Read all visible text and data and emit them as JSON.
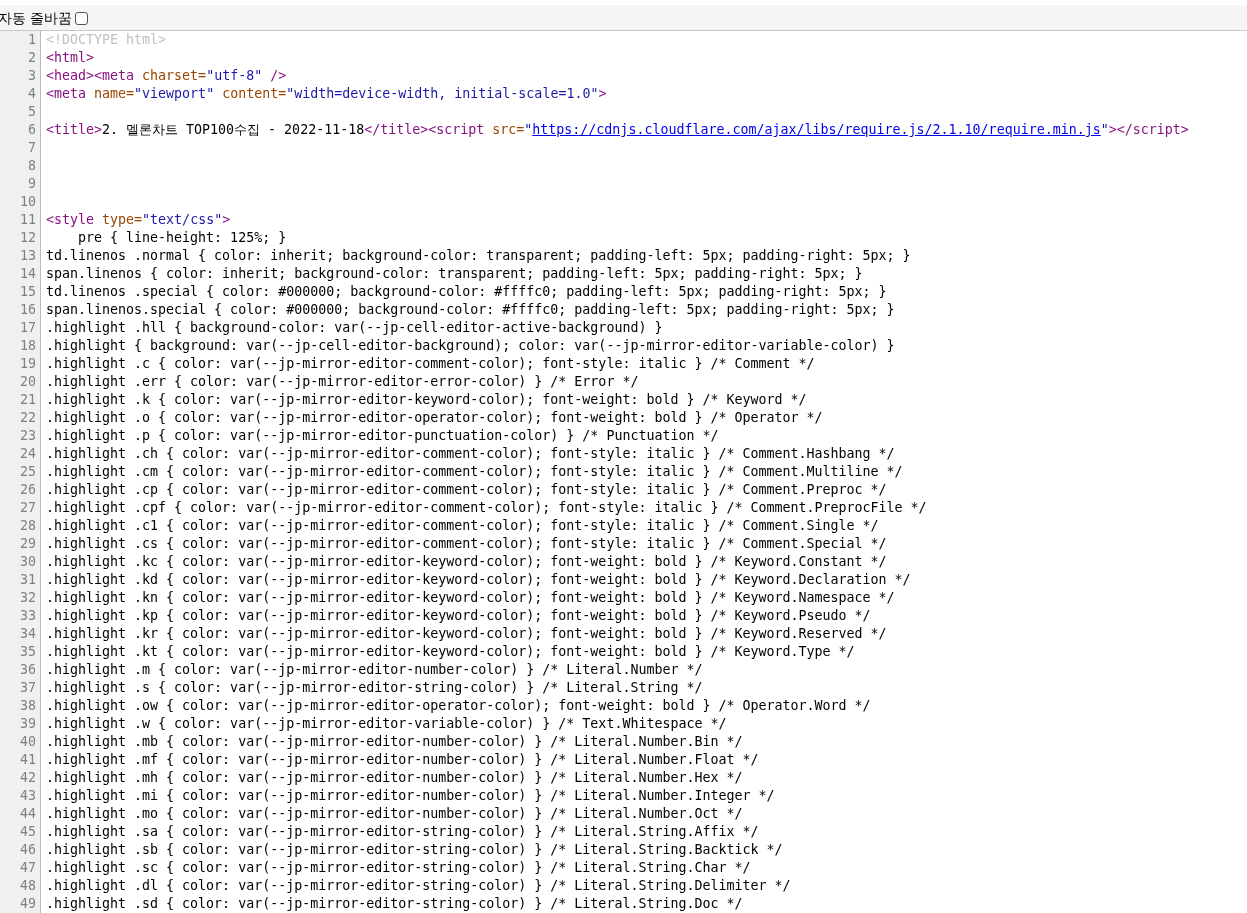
{
  "toolbar": {
    "wrap_checkbox": {
      "label": "자동 줄바꿈",
      "checked": false
    }
  },
  "lines": [
    {
      "number": "1",
      "tokens": [
        {
          "kind": "doctype",
          "text": "<!DOCTYPE html>"
        }
      ]
    },
    {
      "number": "2",
      "tokens": [
        {
          "kind": "tag",
          "text": "<html>"
        }
      ]
    },
    {
      "number": "3",
      "tokens": [
        {
          "kind": "tag",
          "text": "<head><meta"
        },
        {
          "kind": "attr",
          "text": " charset="
        },
        {
          "kind": "value",
          "text": "\"utf-8\""
        },
        {
          "kind": "tag",
          "text": " />"
        }
      ]
    },
    {
      "number": "4",
      "tokens": [
        {
          "kind": "tag",
          "text": "<meta"
        },
        {
          "kind": "attr",
          "text": " name="
        },
        {
          "kind": "value",
          "text": "\"viewport\""
        },
        {
          "kind": "attr",
          "text": " content="
        },
        {
          "kind": "value",
          "text": "\"width=device-width, initial-scale=1.0\""
        },
        {
          "kind": "tag",
          "text": ">"
        }
      ]
    },
    {
      "number": "5"
    },
    {
      "number": "6",
      "tokens": [
        {
          "kind": "tag",
          "text": "<title>"
        },
        {
          "kind": "text",
          "text": "2. 멜론차트 TOP100수집 - 2022-11-18"
        },
        {
          "kind": "tag",
          "text": "</title><script"
        },
        {
          "kind": "attr",
          "text": " src="
        },
        {
          "kind": "value",
          "text": "\""
        },
        {
          "kind": "link",
          "text": "https://cdnjs.cloudflare.com/ajax/libs/require.js/2.1.10/require.min.js"
        },
        {
          "kind": "value",
          "text": "\""
        },
        {
          "kind": "tag",
          "text": "></script>"
        }
      ]
    },
    {
      "number": "7"
    },
    {
      "number": "8"
    },
    {
      "number": "9"
    },
    {
      "number": "10"
    },
    {
      "number": "11",
      "tokens": [
        {
          "kind": "tag",
          "text": "<style"
        },
        {
          "kind": "attr",
          "text": " type="
        },
        {
          "kind": "value",
          "text": "\"text/css\""
        },
        {
          "kind": "tag",
          "text": ">"
        }
      ]
    },
    {
      "number": "12",
      "tokens": [
        {
          "kind": "text",
          "text": "    pre { line-height: 125%; }"
        }
      ]
    },
    {
      "number": "13",
      "tokens": [
        {
          "kind": "text",
          "text": "td.linenos .normal { color: inherit; background-color: transparent; padding-left: 5px; padding-right: 5px; }"
        }
      ]
    },
    {
      "number": "14",
      "tokens": [
        {
          "kind": "text",
          "text": "span.linenos { color: inherit; background-color: transparent; padding-left: 5px; padding-right: 5px; }"
        }
      ]
    },
    {
      "number": "15",
      "tokens": [
        {
          "kind": "text",
          "text": "td.linenos .special { color: #000000; background-color: #ffffc0; padding-left: 5px; padding-right: 5px; }"
        }
      ]
    },
    {
      "number": "16",
      "tokens": [
        {
          "kind": "text",
          "text": "span.linenos.special { color: #000000; background-color: #ffffc0; padding-left: 5px; padding-right: 5px; }"
        }
      ]
    },
    {
      "number": "17",
      "tokens": [
        {
          "kind": "text",
          "text": ".highlight .hll { background-color: var(--jp-cell-editor-active-background) }"
        }
      ]
    },
    {
      "number": "18",
      "tokens": [
        {
          "kind": "text",
          "text": ".highlight { background: var(--jp-cell-editor-background); color: var(--jp-mirror-editor-variable-color) }"
        }
      ]
    },
    {
      "number": "19",
      "tokens": [
        {
          "kind": "text",
          "text": ".highlight .c { color: var(--jp-mirror-editor-comment-color); font-style: italic } /* Comment */"
        }
      ]
    },
    {
      "number": "20",
      "tokens": [
        {
          "kind": "text",
          "text": ".highlight .err { color: var(--jp-mirror-editor-error-color) } /* Error */"
        }
      ]
    },
    {
      "number": "21",
      "tokens": [
        {
          "kind": "text",
          "text": ".highlight .k { color: var(--jp-mirror-editor-keyword-color); font-weight: bold } /* Keyword */"
        }
      ]
    },
    {
      "number": "22",
      "tokens": [
        {
          "kind": "text",
          "text": ".highlight .o { color: var(--jp-mirror-editor-operator-color); font-weight: bold } /* Operator */"
        }
      ]
    },
    {
      "number": "23",
      "tokens": [
        {
          "kind": "text",
          "text": ".highlight .p { color: var(--jp-mirror-editor-punctuation-color) } /* Punctuation */"
        }
      ]
    },
    {
      "number": "24",
      "tokens": [
        {
          "kind": "text",
          "text": ".highlight .ch { color: var(--jp-mirror-editor-comment-color); font-style: italic } /* Comment.Hashbang */"
        }
      ]
    },
    {
      "number": "25",
      "tokens": [
        {
          "kind": "text",
          "text": ".highlight .cm { color: var(--jp-mirror-editor-comment-color); font-style: italic } /* Comment.Multiline */"
        }
      ]
    },
    {
      "number": "26",
      "tokens": [
        {
          "kind": "text",
          "text": ".highlight .cp { color: var(--jp-mirror-editor-comment-color); font-style: italic } /* Comment.Preproc */"
        }
      ]
    },
    {
      "number": "27",
      "tokens": [
        {
          "kind": "text",
          "text": ".highlight .cpf { color: var(--jp-mirror-editor-comment-color); font-style: italic } /* Comment.PreprocFile */"
        }
      ]
    },
    {
      "number": "28",
      "tokens": [
        {
          "kind": "text",
          "text": ".highlight .c1 { color: var(--jp-mirror-editor-comment-color); font-style: italic } /* Comment.Single */"
        }
      ]
    },
    {
      "number": "29",
      "tokens": [
        {
          "kind": "text",
          "text": ".highlight .cs { color: var(--jp-mirror-editor-comment-color); font-style: italic } /* Comment.Special */"
        }
      ]
    },
    {
      "number": "30",
      "tokens": [
        {
          "kind": "text",
          "text": ".highlight .kc { color: var(--jp-mirror-editor-keyword-color); font-weight: bold } /* Keyword.Constant */"
        }
      ]
    },
    {
      "number": "31",
      "tokens": [
        {
          "kind": "text",
          "text": ".highlight .kd { color: var(--jp-mirror-editor-keyword-color); font-weight: bold } /* Keyword.Declaration */"
        }
      ]
    },
    {
      "number": "32",
      "tokens": [
        {
          "kind": "text",
          "text": ".highlight .kn { color: var(--jp-mirror-editor-keyword-color); font-weight: bold } /* Keyword.Namespace */"
        }
      ]
    },
    {
      "number": "33",
      "tokens": [
        {
          "kind": "text",
          "text": ".highlight .kp { color: var(--jp-mirror-editor-keyword-color); font-weight: bold } /* Keyword.Pseudo */"
        }
      ]
    },
    {
      "number": "34",
      "tokens": [
        {
          "kind": "text",
          "text": ".highlight .kr { color: var(--jp-mirror-editor-keyword-color); font-weight: bold } /* Keyword.Reserved */"
        }
      ]
    },
    {
      "number": "35",
      "tokens": [
        {
          "kind": "text",
          "text": ".highlight .kt { color: var(--jp-mirror-editor-keyword-color); font-weight: bold } /* Keyword.Type */"
        }
      ]
    },
    {
      "number": "36",
      "tokens": [
        {
          "kind": "text",
          "text": ".highlight .m { color: var(--jp-mirror-editor-number-color) } /* Literal.Number */"
        }
      ]
    },
    {
      "number": "37",
      "tokens": [
        {
          "kind": "text",
          "text": ".highlight .s { color: var(--jp-mirror-editor-string-color) } /* Literal.String */"
        }
      ]
    },
    {
      "number": "38",
      "tokens": [
        {
          "kind": "text",
          "text": ".highlight .ow { color: var(--jp-mirror-editor-operator-color); font-weight: bold } /* Operator.Word */"
        }
      ]
    },
    {
      "number": "39",
      "tokens": [
        {
          "kind": "text",
          "text": ".highlight .w { color: var(--jp-mirror-editor-variable-color) } /* Text.Whitespace */"
        }
      ]
    },
    {
      "number": "40",
      "tokens": [
        {
          "kind": "text",
          "text": ".highlight .mb { color: var(--jp-mirror-editor-number-color) } /* Literal.Number.Bin */"
        }
      ]
    },
    {
      "number": "41",
      "tokens": [
        {
          "kind": "text",
          "text": ".highlight .mf { color: var(--jp-mirror-editor-number-color) } /* Literal.Number.Float */"
        }
      ]
    },
    {
      "number": "42",
      "tokens": [
        {
          "kind": "text",
          "text": ".highlight .mh { color: var(--jp-mirror-editor-number-color) } /* Literal.Number.Hex */"
        }
      ]
    },
    {
      "number": "43",
      "tokens": [
        {
          "kind": "text",
          "text": ".highlight .mi { color: var(--jp-mirror-editor-number-color) } /* Literal.Number.Integer */"
        }
      ]
    },
    {
      "number": "44",
      "tokens": [
        {
          "kind": "text",
          "text": ".highlight .mo { color: var(--jp-mirror-editor-number-color) } /* Literal.Number.Oct */"
        }
      ]
    },
    {
      "number": "45",
      "tokens": [
        {
          "kind": "text",
          "text": ".highlight .sa { color: var(--jp-mirror-editor-string-color) } /* Literal.String.Affix */"
        }
      ]
    },
    {
      "number": "46",
      "tokens": [
        {
          "kind": "text",
          "text": ".highlight .sb { color: var(--jp-mirror-editor-string-color) } /* Literal.String.Backtick */"
        }
      ]
    },
    {
      "number": "47",
      "tokens": [
        {
          "kind": "text",
          "text": ".highlight .sc { color: var(--jp-mirror-editor-string-color) } /* Literal.String.Char */"
        }
      ]
    },
    {
      "number": "48",
      "tokens": [
        {
          "kind": "text",
          "text": ".highlight .dl { color: var(--jp-mirror-editor-string-color) } /* Literal.String.Delimiter */"
        }
      ]
    },
    {
      "number": "49",
      "tokens": [
        {
          "kind": "text",
          "text": ".highlight .sd { color: var(--jp-mirror-editor-string-color) } /* Literal.String.Doc */"
        }
      ]
    }
  ]
}
